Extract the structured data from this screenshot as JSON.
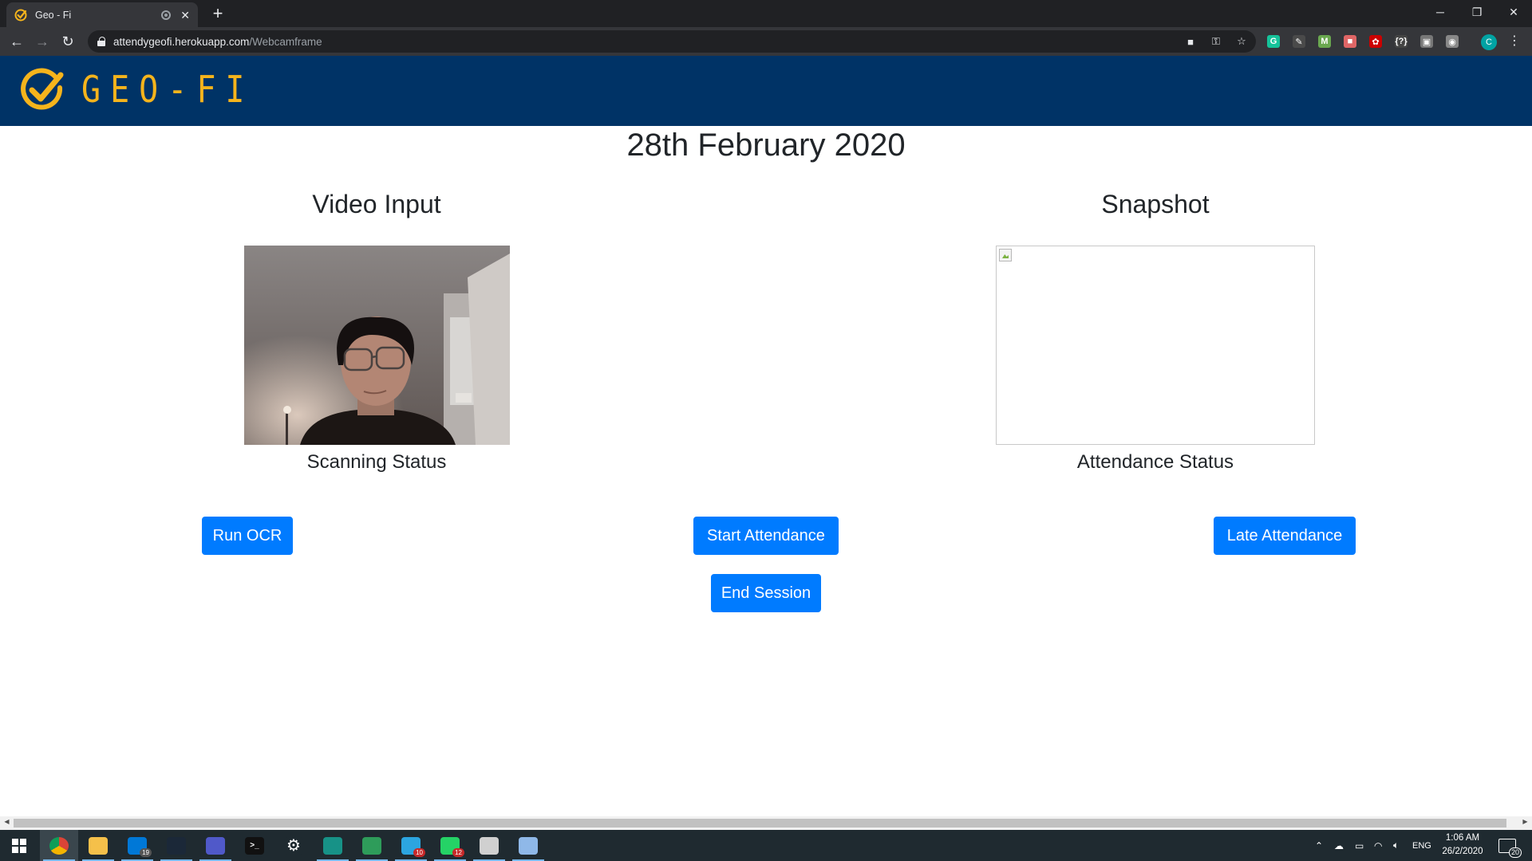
{
  "browser": {
    "tab_title": "Geo - Fi",
    "new_tab_symbol": "+",
    "url_host": "attendygeofi.herokuapp.com",
    "url_path": "/Webcamframe",
    "profile_initial": "C",
    "window_controls": [
      "─",
      "❐",
      "✕"
    ],
    "extensions": [
      {
        "name": "grammarly-icon",
        "glyph": "G",
        "color": "#15c39a"
      },
      {
        "name": "color-picker-icon",
        "glyph": "✎",
        "color": "#4a4a4a"
      },
      {
        "name": "m-extension-icon",
        "glyph": "M",
        "color": "#6aa84f"
      },
      {
        "name": "palette-extension-icon",
        "glyph": "■",
        "color": "#e06666"
      },
      {
        "name": "red-extension-icon",
        "glyph": "✿",
        "color": "#cc0000"
      },
      {
        "name": "bracket-extension-icon",
        "glyph": "{?}",
        "color": "#444444"
      },
      {
        "name": "gray-extension-icon",
        "glyph": "▣",
        "color": "#777777"
      },
      {
        "name": "camera-extension-icon",
        "glyph": "◉",
        "color": "#888888"
      }
    ]
  },
  "navbar": {
    "brand_text": "GEO-FI",
    "brand_color": "#f5b41c",
    "background": "#003366"
  },
  "page": {
    "date": "28th February 2020",
    "video_title": "Video Input",
    "snapshot_title": "Snapshot",
    "scanning_status": "Scanning Status",
    "attendance_status": "Attendance Status"
  },
  "buttons": {
    "run_ocr": "Run OCR",
    "start_attendance": "Start Attendance",
    "late_attendance": "Late Attendance",
    "end_session": "End Session",
    "color": "#007bff"
  },
  "taskbar": {
    "apps": [
      {
        "name": "start-button",
        "color": "#1f2a30"
      },
      {
        "name": "chrome-icon",
        "color": "#db4437"
      },
      {
        "name": "file-explorer-icon",
        "color": "#f5c04a"
      },
      {
        "name": "mail-icon",
        "color": "#0078d7",
        "badge": "19"
      },
      {
        "name": "steam-icon",
        "color": "#1b2838"
      },
      {
        "name": "teams-icon",
        "color": "#5059c9"
      },
      {
        "name": "terminal-icon",
        "color": "#111111"
      },
      {
        "name": "settings-icon",
        "color": "#1f2a30"
      },
      {
        "name": "gitkraken-icon",
        "color": "#179287"
      },
      {
        "name": "app-green-icon",
        "color": "#2e9c5a"
      },
      {
        "name": "telegram-icon",
        "color": "#2ca5e0",
        "badge": "10"
      },
      {
        "name": "whatsapp-icon",
        "color": "#25d366",
        "badge": "12"
      },
      {
        "name": "paint-icon",
        "color": "#d0d0d0"
      },
      {
        "name": "paint3d-icon",
        "color": "#8fb8e8"
      }
    ],
    "language": "ENG",
    "time": "1:06 AM",
    "date": "26/2/2020",
    "notification_count": "20"
  }
}
